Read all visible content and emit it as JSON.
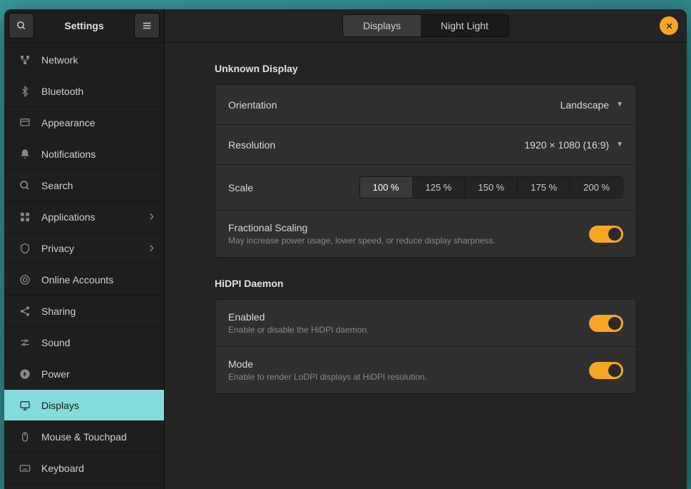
{
  "header": {
    "title": "Settings"
  },
  "sidebar": {
    "items": [
      {
        "label": "Network",
        "icon": "network"
      },
      {
        "label": "Bluetooth",
        "icon": "bluetooth"
      },
      {
        "label": "Appearance",
        "icon": "appearance"
      },
      {
        "label": "Notifications",
        "icon": "notifications"
      },
      {
        "label": "Search",
        "icon": "search"
      },
      {
        "label": "Applications",
        "icon": "apps",
        "chevron": true
      },
      {
        "label": "Privacy",
        "icon": "privacy",
        "chevron": true
      },
      {
        "label": "Online Accounts",
        "icon": "accounts"
      },
      {
        "label": "Sharing",
        "icon": "sharing"
      },
      {
        "label": "Sound",
        "icon": "sound"
      },
      {
        "label": "Power",
        "icon": "power"
      },
      {
        "label": "Displays",
        "icon": "displays",
        "active": true
      },
      {
        "label": "Mouse & Touchpad",
        "icon": "mouse"
      },
      {
        "label": "Keyboard",
        "icon": "keyboard"
      }
    ]
  },
  "tabs": {
    "displays": "Displays",
    "night_light": "Night Light",
    "active": "displays"
  },
  "sections": {
    "display_name": "Unknown Display",
    "hidpi_title": "HiDPI Daemon"
  },
  "rows": {
    "orientation": {
      "label": "Orientation",
      "value": "Landscape"
    },
    "resolution": {
      "label": "Resolution",
      "value": "1920 × 1080 (16:9)"
    },
    "scale": {
      "label": "Scale",
      "options": [
        "100 %",
        "125 %",
        "150 %",
        "175 %",
        "200 %"
      ],
      "active": "100 %"
    },
    "fractional": {
      "label": "Fractional Scaling",
      "sub": "May increase power usage, lower speed, or reduce display sharpness.",
      "on": true
    },
    "enabled": {
      "label": "Enabled",
      "sub": "Enable or disable the HiDPI daemon.",
      "on": true
    },
    "mode": {
      "label": "Mode",
      "sub": "Enable to render LoDPI displays at HiDPI resolution.",
      "on": true
    }
  }
}
